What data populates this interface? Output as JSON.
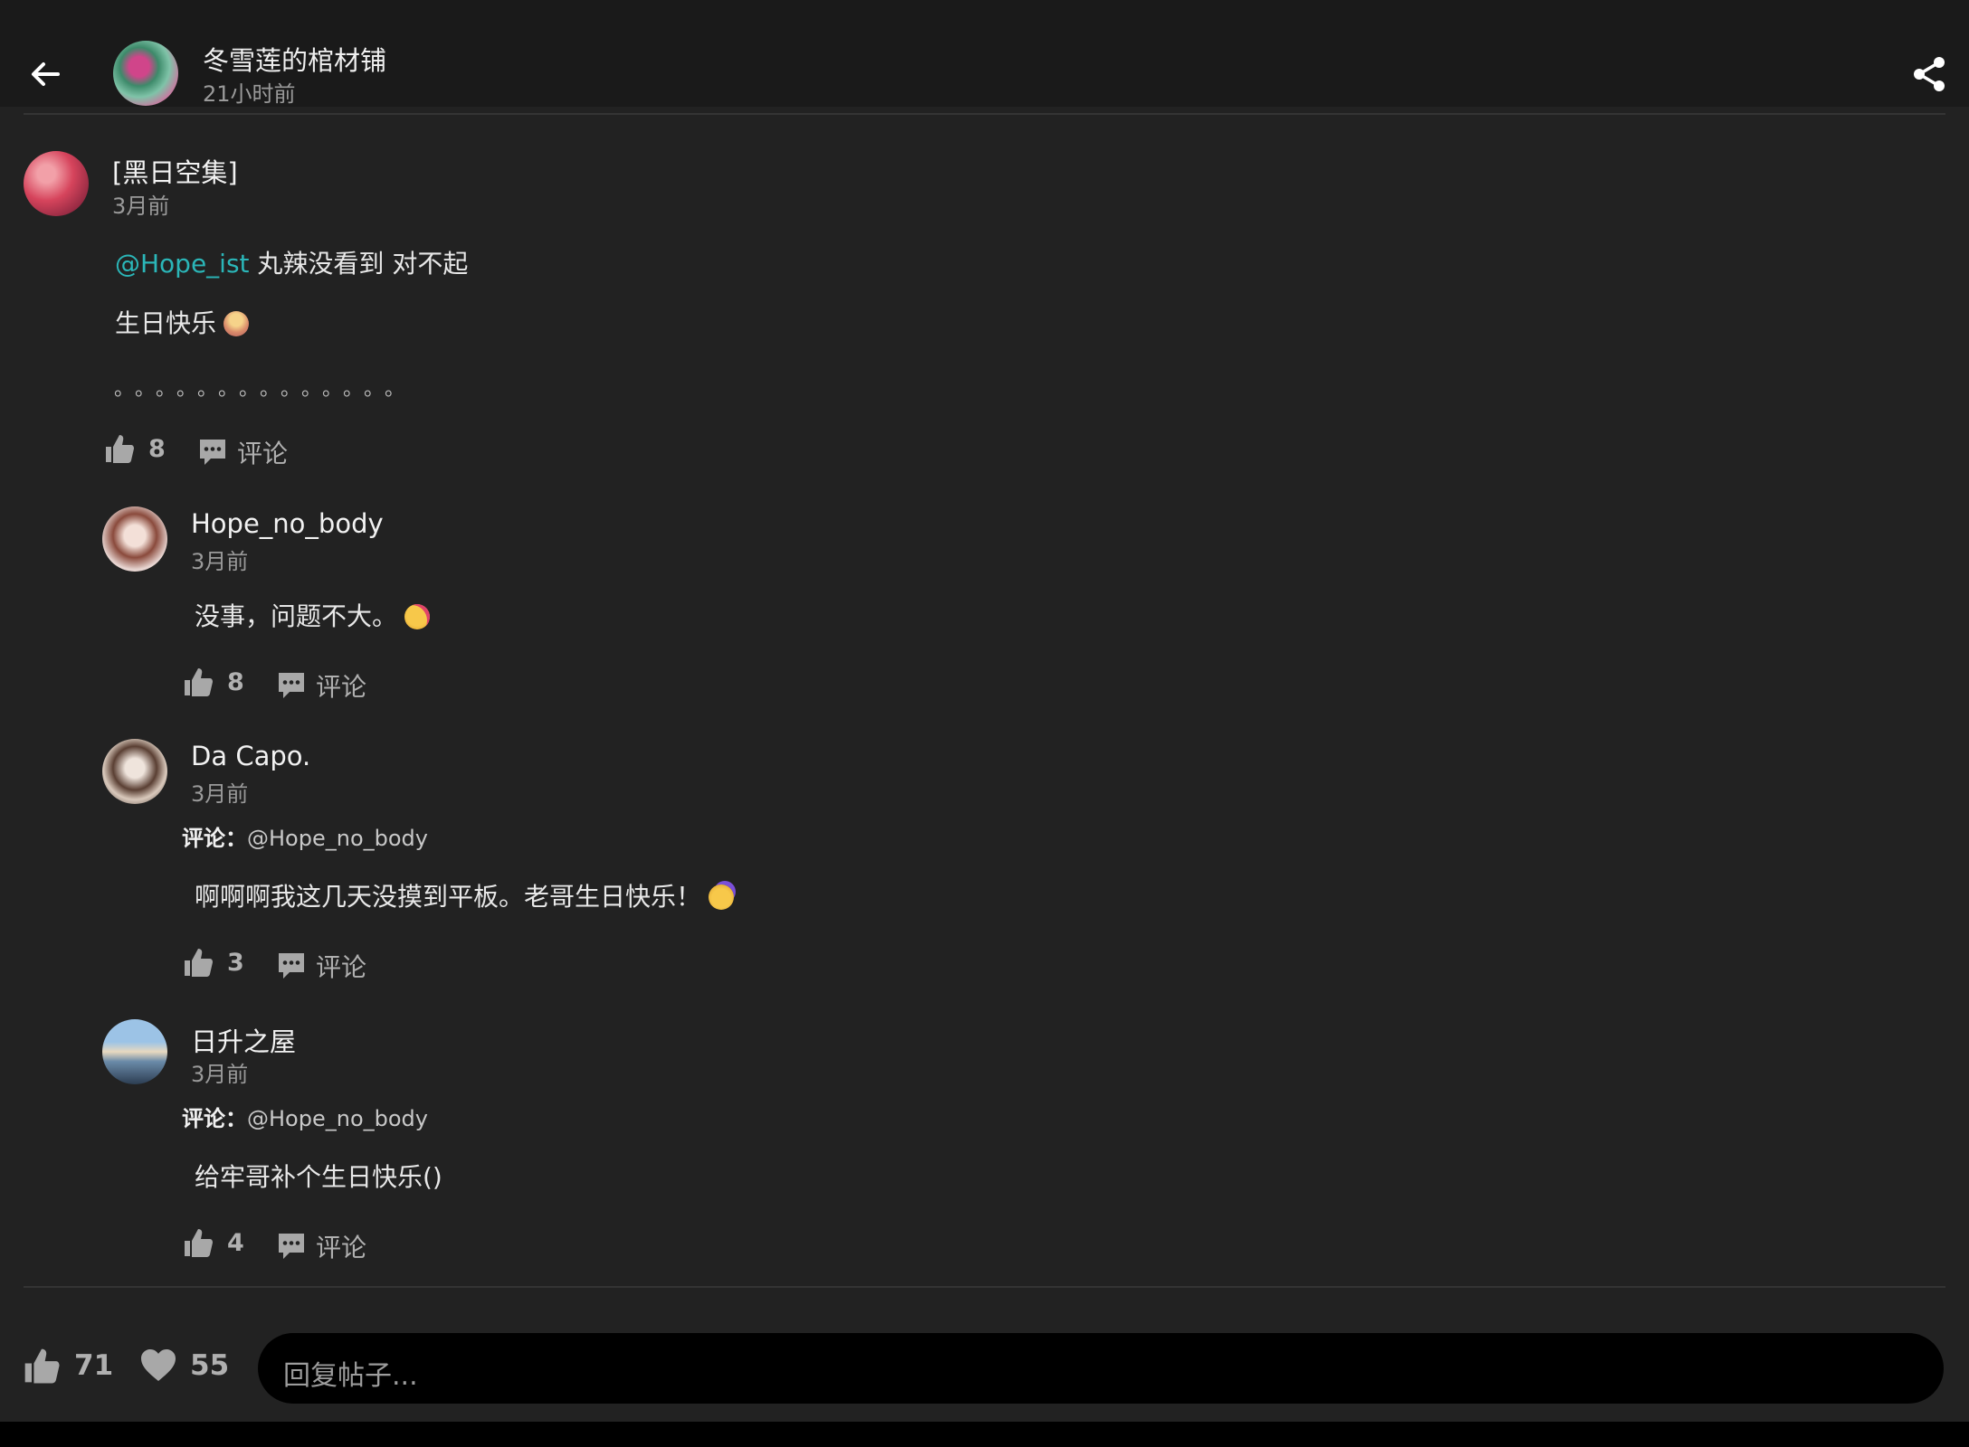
{
  "header": {
    "title": "冬雪莲的棺材铺",
    "time": "21小时前",
    "back_icon": "arrow-left-icon",
    "share_icon": "share-icon"
  },
  "main_comment": {
    "author": "[黑日空集]",
    "time": "3月前",
    "mention": "@Hope_ist",
    "line1_text": " 丸辣没看到 对不起",
    "line2_text": "生日快乐",
    "line2_emoji": "birthday-cake-emoji",
    "line3_text": "。。。。。。。。。。。。。。",
    "likes": "8",
    "comment_label": "评论"
  },
  "replies": [
    {
      "author": "Hope_no_body",
      "time": "3月前",
      "text": "没事，问题不大。",
      "emoji": "kissing-face-emoji",
      "likes": "8",
      "comment_label": "评论"
    },
    {
      "author": "Da Capo.",
      "time": "3月前",
      "reply_label": "评论：",
      "reply_target": "@Hope_no_body",
      "text": "啊啊啊我这几天没摸到平板。老哥生日快乐！",
      "emoji": "party-face-emoji",
      "likes": "3",
      "comment_label": "评论"
    },
    {
      "author": "日升之屋",
      "time": "3月前",
      "reply_label": "评论：",
      "reply_target": "@Hope_no_body",
      "text": "给牢哥补个生日快乐()",
      "likes": "4",
      "comment_label": "评论"
    }
  ],
  "footer": {
    "likes": "71",
    "favorites": "55",
    "reply_placeholder": "回复帖子..."
  },
  "colors": {
    "background": "#222222",
    "topbar": "#1a1a1a",
    "mention": "#2bb6b8",
    "input": "#000000"
  }
}
